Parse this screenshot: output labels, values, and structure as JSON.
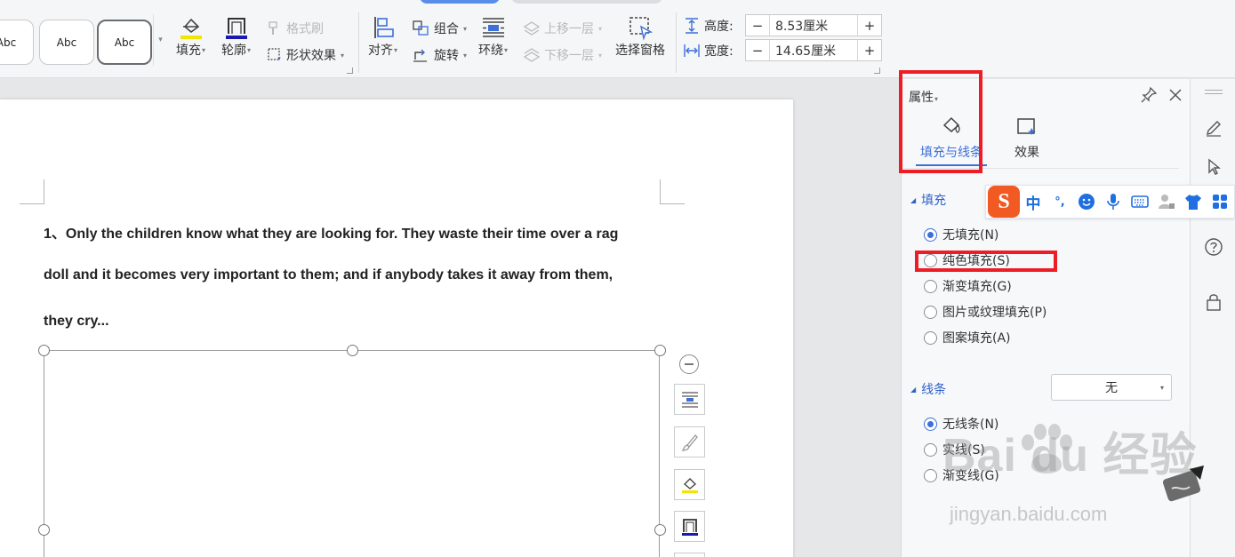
{
  "ribbon": {
    "styles": [
      "Abc",
      "Abc",
      "Abc"
    ],
    "fill_label": "填充",
    "outline_label": "轮廓",
    "format_painter_label": "格式刷",
    "shape_effects_label": "形状效果",
    "align_label": "对齐",
    "group_label": "组合",
    "rotate_label": "旋转",
    "wrap_label": "环绕",
    "bring_forward_label": "上移一层",
    "send_backward_label": "下移一层",
    "selection_pane_label": "选择窗格",
    "height_label": "高度:",
    "height_value": "8.53厘米",
    "width_label": "宽度:",
    "width_value": "14.65厘米",
    "minus": "−",
    "plus": "+"
  },
  "document": {
    "lines": [
      "1、Only the children know what they are looking for. They waste their time over a rag",
      "doll and it becomes very important to them; and if anybody takes it away from them,",
      "they cry..."
    ]
  },
  "pane": {
    "title": "属性",
    "tabs": [
      {
        "label": "填充与线条",
        "active": true
      },
      {
        "label": "效果",
        "active": false
      }
    ],
    "fill_section": {
      "title": "填充",
      "options": [
        {
          "label": "无填充(N)",
          "selected": true
        },
        {
          "label": "纯色填充(S)",
          "selected": false
        },
        {
          "label": "渐变填充(G)",
          "selected": false
        },
        {
          "label": "图片或纹理填充(P)",
          "selected": false
        },
        {
          "label": "图案填充(A)",
          "selected": false
        }
      ]
    },
    "line_section": {
      "title": "线条",
      "dropdown_value": "无",
      "options": [
        {
          "label": "无线条(N)",
          "selected": true
        },
        {
          "label": "实线(S)",
          "selected": false
        },
        {
          "label": "渐变线(G)",
          "selected": false
        }
      ]
    }
  },
  "ime": {
    "logo": "S",
    "mode": "中",
    "punct": "°,"
  },
  "watermark": {
    "logo": "Bai  du 经验",
    "site": "jingyan.baidu.com"
  },
  "colors": {
    "accent": "#3d6fd8",
    "highlight": "#ee1c24",
    "ime_brand": "#f25a24"
  }
}
